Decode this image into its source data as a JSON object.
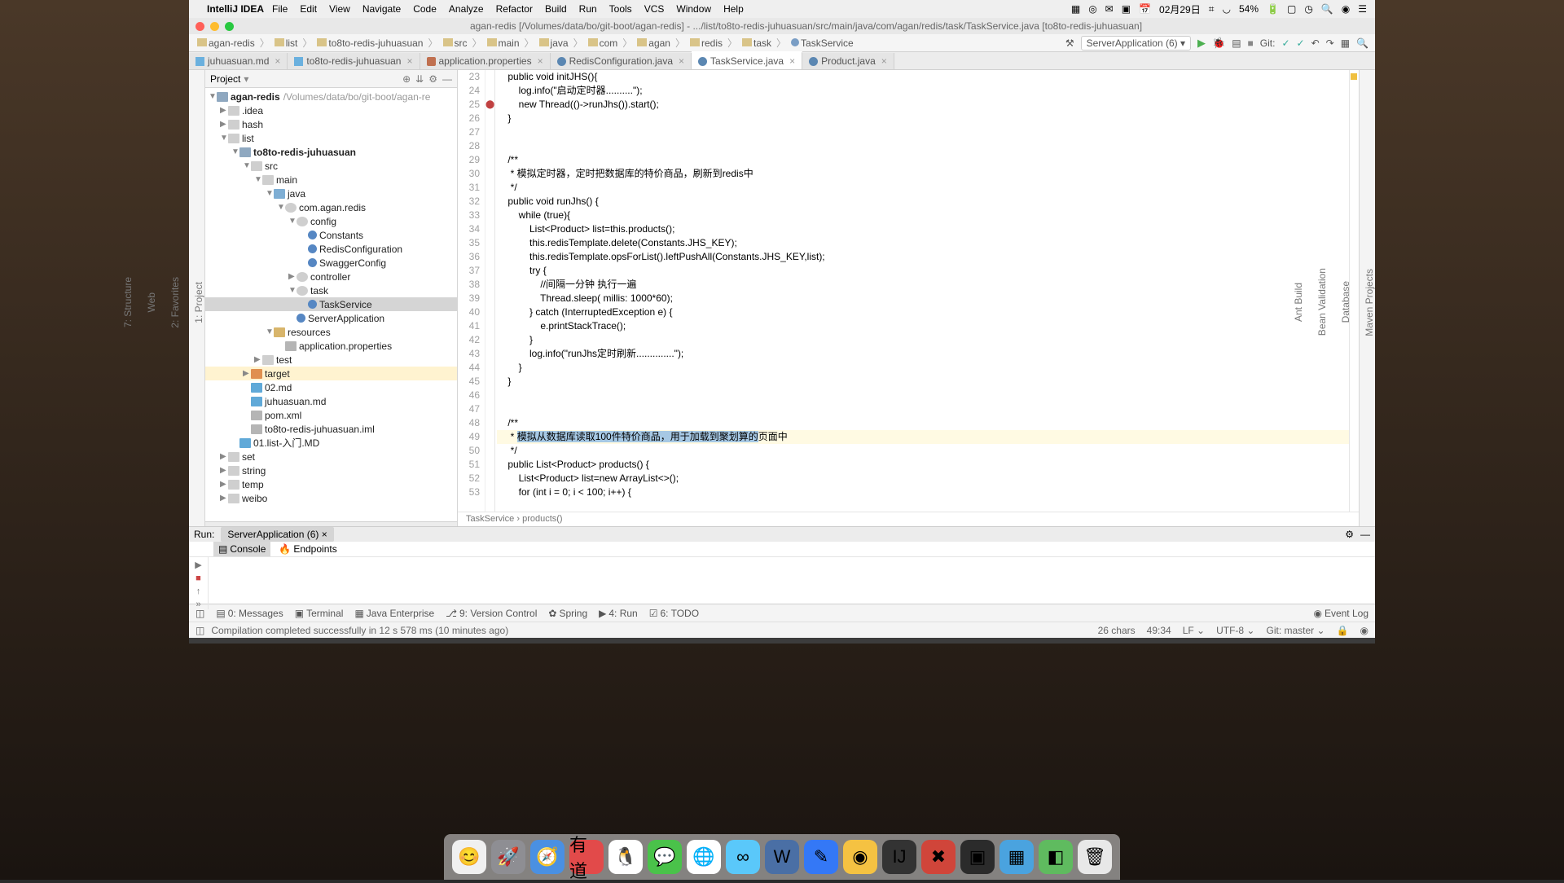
{
  "os_menu": {
    "app": "IntelliJ IDEA",
    "items": [
      "File",
      "Edit",
      "View",
      "Navigate",
      "Code",
      "Analyze",
      "Refactor",
      "Build",
      "Run",
      "Tools",
      "VCS",
      "Window",
      "Help"
    ],
    "date": "02月29日",
    "battery": "54%"
  },
  "window_title": "agan-redis [/Volumes/data/bo/git-boot/agan-redis] - .../list/to8to-redis-juhuasuan/src/main/java/com/agan/redis/task/TaskService.java [to8to-redis-juhuasuan]",
  "breadcrumbs": [
    "agan-redis",
    "list",
    "to8to-redis-juhuasuan",
    "src",
    "main",
    "java",
    "com",
    "agan",
    "redis",
    "task",
    "TaskService"
  ],
  "run_config": "ServerApplication (6)",
  "git_label": "Git:",
  "tabs": [
    {
      "name": "juhuasuan.md",
      "type": "md"
    },
    {
      "name": "to8to-redis-juhuasuan",
      "type": "md"
    },
    {
      "name": "application.properties",
      "type": "prop"
    },
    {
      "name": "RedisConfiguration.java",
      "type": "java"
    },
    {
      "name": "TaskService.java",
      "type": "java",
      "active": true
    },
    {
      "name": "Product.java",
      "type": "java"
    }
  ],
  "project": {
    "title": "Project",
    "root": {
      "name": "agan-redis",
      "path": "/Volumes/data/bo/git-boot/agan-re"
    },
    "nodes": [
      {
        "d": 0,
        "a": "▼",
        "i": "mod",
        "t": "agan-redis",
        "p": "/Volumes/data/bo/git-boot/agan-re",
        "bold": true
      },
      {
        "d": 1,
        "a": "▶",
        "i": "fold",
        "t": ".idea"
      },
      {
        "d": 1,
        "a": "▶",
        "i": "fold",
        "t": "hash"
      },
      {
        "d": 1,
        "a": "▼",
        "i": "fold",
        "t": "list"
      },
      {
        "d": 2,
        "a": "▼",
        "i": "mod",
        "t": "to8to-redis-juhuasuan",
        "bold": true
      },
      {
        "d": 3,
        "a": "▼",
        "i": "fold",
        "t": "src"
      },
      {
        "d": 4,
        "a": "▼",
        "i": "fold",
        "t": "main"
      },
      {
        "d": 5,
        "a": "▼",
        "i": "src",
        "t": "java"
      },
      {
        "d": 6,
        "a": "▼",
        "i": "pkg",
        "t": "com.agan.redis"
      },
      {
        "d": 7,
        "a": "▼",
        "i": "pkg",
        "t": "config"
      },
      {
        "d": 8,
        "a": "",
        "i": "cls",
        "t": "Constants"
      },
      {
        "d": 8,
        "a": "",
        "i": "cls",
        "t": "RedisConfiguration"
      },
      {
        "d": 8,
        "a": "",
        "i": "cls",
        "t": "SwaggerConfig"
      },
      {
        "d": 7,
        "a": "▶",
        "i": "pkg",
        "t": "controller"
      },
      {
        "d": 7,
        "a": "▼",
        "i": "pkg",
        "t": "task"
      },
      {
        "d": 8,
        "a": "",
        "i": "cls",
        "t": "TaskService",
        "sel": true
      },
      {
        "d": 7,
        "a": "",
        "i": "cls",
        "t": "ServerApplication"
      },
      {
        "d": 5,
        "a": "▼",
        "i": "res",
        "t": "resources"
      },
      {
        "d": 6,
        "a": "",
        "i": "file",
        "t": "application.properties"
      },
      {
        "d": 4,
        "a": "▶",
        "i": "fold",
        "t": "test"
      },
      {
        "d": 3,
        "a": "▶",
        "i": "tgt",
        "t": "target",
        "hl": true
      },
      {
        "d": 3,
        "a": "",
        "i": "md",
        "t": "02.md"
      },
      {
        "d": 3,
        "a": "",
        "i": "md",
        "t": "juhuasuan.md"
      },
      {
        "d": 3,
        "a": "",
        "i": "file",
        "t": "pom.xml"
      },
      {
        "d": 3,
        "a": "",
        "i": "file",
        "t": "to8to-redis-juhuasuan.iml"
      },
      {
        "d": 2,
        "a": "",
        "i": "md",
        "t": "01.list-入门.MD"
      },
      {
        "d": 1,
        "a": "▶",
        "i": "fold",
        "t": "set"
      },
      {
        "d": 1,
        "a": "▶",
        "i": "fold",
        "t": "string"
      },
      {
        "d": 1,
        "a": "▶",
        "i": "fold",
        "t": "temp"
      },
      {
        "d": 1,
        "a": "▶",
        "i": "fold",
        "t": "weibo"
      }
    ]
  },
  "code": {
    "first_line": 23,
    "lines": [
      "    <kw>public</kw> <kw>void</kw> initJHS(){",
      "        <stat>log</stat>.info(<str>\"启动定时器..........\"</str>);",
      "        <kw>new</kw> Thread(()-><mth2>runJhs</mth2>()).start();",
      "    }",
      "",
      "",
      "    <doc>/**</doc>",
      "     <doc>* 模拟定时器，定时把数据库的特价商品，刷新到</doc><docit>redis</docit><doc>中</doc>",
      "     <doc>*/</doc>",
      "    <kw>public</kw> <kw>void</kw> runJhs() {",
      "        <kw>while</kw> (<kw>true</kw>){",
      "            List&lt;Product&gt; list=<kw>this</kw>.products();",
      "            <kw>this</kw>.<fld>redisTemplate</fld>.delete(Constants.<con>JHS_KEY</con>);",
      "            <kw>this</kw>.<fld>redisTemplate</fld>.opsForList().leftPushAll(Constants.<con>JHS_KEY</con>,list);",
      "            <kw>try</kw> {",
      "                <cmt>//间隔一分钟 执行一遍</cmt>",
      "                Thread.<mth2>sleep</mth2>( <param>millis:</param> <num>1000</num>*<num>60</num>);",
      "            } <kw>catch</kw> (InterruptedException e) {",
      "                e.printStackTrace();",
      "            }",
      "            <stat>log</stat>.info(<str>\"runJhs定时刷新..............\"</str>);",
      "        }",
      "    }",
      "",
      "",
      "    <doc>/**</doc>",
      "     <doc>* <span class=sel>模拟从数据库读取</span></doc><span class=sel><docit>100</docit></span><span class=sel><doc>件特价商品，用于加载到聚划算的</doc></span><doc>页面中</doc>",
      "     <doc>*/</doc>",
      "    <kw>public</kw> List&lt;Product&gt; products() {",
      "        List&lt;Product&gt; list=<kw>new</kw> ArrayList&lt;&gt;();",
      "        <kw>for</kw> (<kw>int</kw> i = <num>0</num>; i &lt; <num>100</num>; i++) {"
    ],
    "hl_line": 49,
    "breadcrumb": "TaskService  ›  products()"
  },
  "run": {
    "label": "Run:",
    "tab": "ServerApplication (6)",
    "subtabs": [
      "Console",
      "Endpoints"
    ]
  },
  "bottom": [
    "0: Messages",
    "Terminal",
    "Java Enterprise",
    "9: Version Control",
    "Spring",
    "4: Run",
    "6: TODO"
  ],
  "event_log": "Event Log",
  "status": {
    "msg": "Compilation completed successfully in 12 s 578 ms (10 minutes ago)",
    "chars": "26 chars",
    "pos": "49:34",
    "le": "LF",
    "enc": "UTF-8",
    "git": "Git: master"
  },
  "side_left": [
    "1: Project",
    "2: Favorites",
    "Web",
    "7: Structure"
  ],
  "side_right": [
    "Maven Projects",
    "Database",
    "Bean Validation",
    "Ant Build"
  ]
}
